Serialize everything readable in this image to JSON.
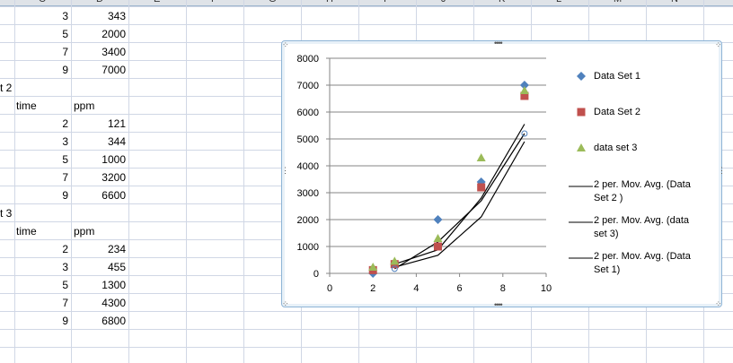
{
  "spreadsheet": {
    "column_headers": [
      "C",
      "D",
      "E",
      "F",
      "G",
      "H",
      "I",
      "J",
      "K",
      "L",
      "M",
      "N"
    ],
    "rows": [
      {
        "label": "",
        "time": "3",
        "ppm": "343"
      },
      {
        "label": "",
        "time": "5",
        "ppm": "2000"
      },
      {
        "label": "",
        "time": "7",
        "ppm": "3400"
      },
      {
        "label": "",
        "time": "9",
        "ppm": "7000"
      },
      {
        "label": "t 2",
        "time": "",
        "ppm": ""
      },
      {
        "label": "",
        "time": "time",
        "ppm": "ppm"
      },
      {
        "label": "",
        "time": "2",
        "ppm": "121"
      },
      {
        "label": "",
        "time": "3",
        "ppm": "344"
      },
      {
        "label": "",
        "time": "5",
        "ppm": "1000"
      },
      {
        "label": "",
        "time": "7",
        "ppm": "3200"
      },
      {
        "label": "",
        "time": "9",
        "ppm": "6600"
      },
      {
        "label": "t 3",
        "time": "",
        "ppm": ""
      },
      {
        "label": "",
        "time": "time",
        "ppm": "ppm"
      },
      {
        "label": "",
        "time": "2",
        "ppm": "234"
      },
      {
        "label": "",
        "time": "3",
        "ppm": "455"
      },
      {
        "label": "",
        "time": "5",
        "ppm": "1300"
      },
      {
        "label": "",
        "time": "7",
        "ppm": "4300"
      },
      {
        "label": "",
        "time": "9",
        "ppm": "6800"
      }
    ]
  },
  "chart_data": {
    "type": "scatter",
    "xlim": [
      0,
      10
    ],
    "ylim": [
      0,
      8000
    ],
    "xticks": [
      "0",
      "2",
      "4",
      "6",
      "8",
      "10"
    ],
    "yticks": [
      "0",
      "1000",
      "2000",
      "3000",
      "4000",
      "5000",
      "6000",
      "7000",
      "8000"
    ],
    "grid": true,
    "legend_position": "right",
    "series": [
      {
        "name": "Data Set 1",
        "marker": "diamond",
        "color": "#4f81bd",
        "x": [
          2,
          3,
          5,
          7,
          9
        ],
        "y": [
          0,
          343,
          2000,
          3400,
          7000
        ]
      },
      {
        "name": "Data Set 2",
        "marker": "square",
        "color": "#c0504d",
        "x": [
          2,
          3,
          5,
          7,
          9
        ],
        "y": [
          121,
          344,
          1000,
          3200,
          6600
        ]
      },
      {
        "name": "data set 3",
        "marker": "triangle",
        "color": "#9bbb59",
        "x": [
          2,
          3,
          5,
          7,
          9
        ],
        "y": [
          234,
          455,
          1300,
          4300,
          6800
        ]
      }
    ],
    "trendlines": [
      {
        "name": "2 per. Mov. Avg. (Data Set 2 )",
        "color": "#000000",
        "x": [
          3,
          5,
          7,
          9
        ],
        "y": [
          232,
          672,
          2100,
          4900
        ]
      },
      {
        "name": "2 per. Mov. Avg. (data set 3)",
        "color": "#000000",
        "x": [
          3,
          5,
          7,
          9
        ],
        "y": [
          344,
          877,
          2800,
          5550
        ]
      },
      {
        "name": "2 per. Mov. Avg. (Data Set 1)",
        "color": "#000000",
        "x": [
          3,
          5,
          7,
          9
        ],
        "y": [
          171,
          1171,
          2700,
          5200
        ]
      }
    ]
  }
}
